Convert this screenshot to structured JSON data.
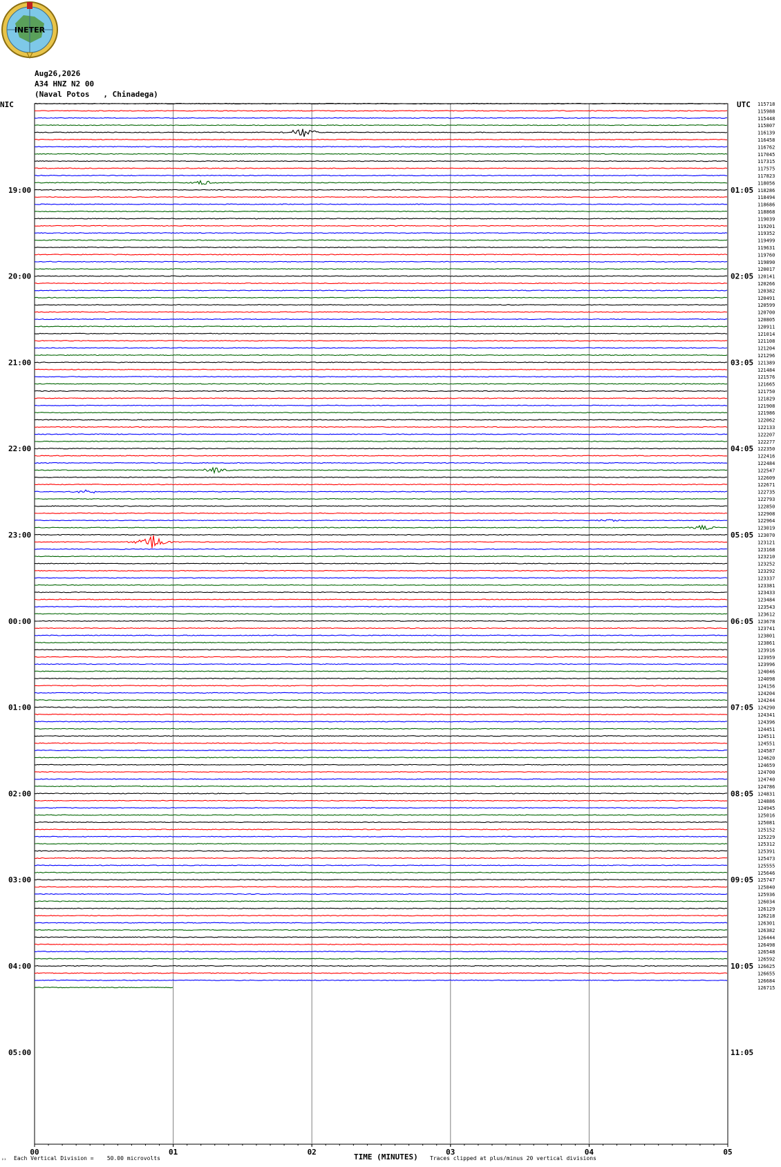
{
  "header": {
    "date": "Aug26,2026",
    "channel": "A34 HNZ N2 00",
    "location": "(Naval Potos   , Chinadega)"
  },
  "logo": {
    "text": "INETER",
    "icon": "ineter-globe-logo"
  },
  "footer": {
    "vertical_division": "Each Vertical Division =    50.00 microvolts",
    "time_label": "TIME (MINUTES)",
    "clip_note": "Traces clipped at plus/minus 20 vertical divisions",
    "corner_mark": "²²"
  },
  "colors": {
    "black": "#000000",
    "red": "#ff0000",
    "blue": "#0000ff",
    "green": "#006400",
    "grid": "#808080"
  },
  "chart_data": {
    "type": "line",
    "title": "",
    "xlabel": "TIME (MINUTES)",
    "ylabel": "",
    "xlim": [
      0,
      5
    ],
    "x_ticks": [
      "00",
      "01",
      "02",
      "03",
      "04",
      "05"
    ],
    "left_axis_title": "NIC",
    "right_axis_title": "UTC",
    "left_hour_labels": [
      "19:00",
      "20:00",
      "21:00",
      "22:00",
      "23:00",
      "00:00",
      "01:00",
      "02:00",
      "03:00",
      "04:00",
      "05:00"
    ],
    "right_hour_labels": [
      "01:05",
      "02:05",
      "03:05",
      "04:05",
      "05:05",
      "06:05",
      "07:05",
      "08:05",
      "09:05",
      "10:05",
      "11:05"
    ],
    "trace_colors_cycle": [
      "black",
      "red",
      "blue",
      "green"
    ],
    "trace_count": 124,
    "last_trace_minutes": 1,
    "right_values": [
      "115718",
      "115988",
      "115448",
      "115807",
      "116139",
      "116458",
      "116762",
      "117045",
      "117315",
      "117575",
      "117823",
      "118056",
      "118286",
      "118494",
      "118686",
      "118868",
      "119039",
      "119201",
      "119352",
      "119499",
      "119631",
      "119760",
      "119890",
      "120017",
      "120141",
      "120266",
      "120382",
      "120491",
      "120599",
      "120700",
      "120805",
      "120911",
      "121014",
      "121108",
      "121204",
      "121296",
      "121389",
      "121484",
      "121576",
      "121665",
      "121750",
      "121829",
      "121908",
      "121986",
      "122062",
      "122133",
      "122207",
      "122277",
      "122350",
      "122416",
      "122484",
      "122547",
      "122609",
      "122671",
      "122735",
      "122793",
      "122850",
      "122908",
      "122964",
      "123019",
      "123070",
      "123121",
      "123168",
      "123210",
      "123252",
      "123292",
      "123337",
      "123381",
      "123433",
      "123484",
      "123543",
      "123612",
      "123678",
      "123741",
      "123801",
      "123861",
      "123916",
      "123959",
      "123996",
      "124046",
      "124098",
      "124156",
      "124204",
      "124244",
      "124290",
      "124341",
      "124396",
      "124451",
      "124511",
      "124551",
      "124587",
      "124620",
      "124659",
      "124700",
      "124740",
      "124786",
      "124831",
      "124886",
      "124945",
      "125016",
      "125081",
      "125152",
      "125229",
      "125312",
      "125391",
      "125473",
      "125555",
      "125646",
      "125747",
      "125840",
      "125936",
      "126034",
      "126129",
      "126218",
      "126301",
      "126382",
      "126444",
      "126498",
      "126548",
      "126592",
      "126625",
      "126655",
      "126684",
      "126715"
    ],
    "events": [
      {
        "trace": 4,
        "minute": 1.93,
        "amplitude": 8
      },
      {
        "trace": 11,
        "minute": 1.22,
        "amplitude": 4
      },
      {
        "trace": 51,
        "minute": 1.29,
        "amplitude": 5
      },
      {
        "trace": 54,
        "minute": 0.38,
        "amplitude": 4
      },
      {
        "trace": 61,
        "minute": 0.85,
        "amplitude": 11
      },
      {
        "trace": 59,
        "minute": 4.82,
        "amplitude": 4
      },
      {
        "trace": 58,
        "minute": 4.15,
        "amplitude": 3
      }
    ]
  }
}
